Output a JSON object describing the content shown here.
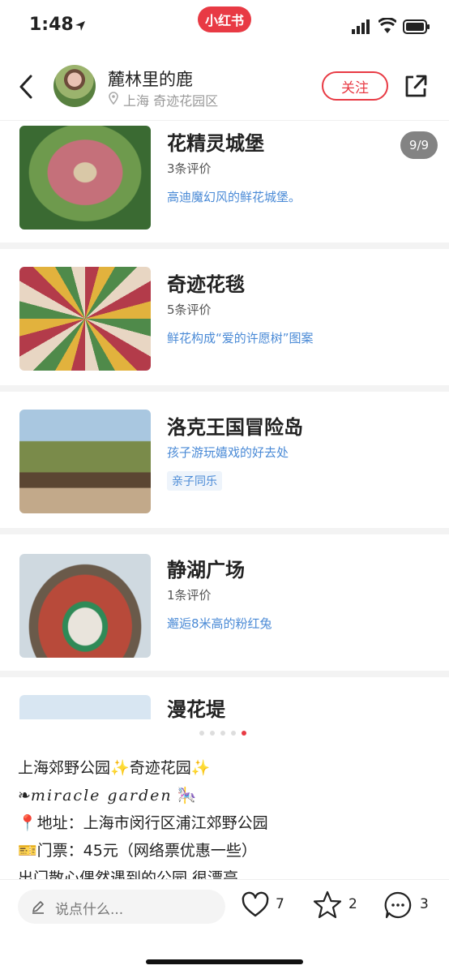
{
  "status_bar": {
    "time": "1:48",
    "brand": "小红书"
  },
  "header": {
    "author": "麓林里的鹿",
    "location": "上海 奇迹花园区",
    "follow_label": "关注"
  },
  "carousel": {
    "counter": "9/9",
    "cards": [
      {
        "title": "花精灵城堡",
        "meta": "3条评价",
        "desc": "高迪魔幻风的鲜花城堡。"
      },
      {
        "title": "奇迹花毯",
        "meta": "5条评价",
        "desc": "鲜花构成“爱的许愿树”图案"
      },
      {
        "title": "洛克王国冒险岛",
        "desc": "孩子游玩嬉戏的好去处",
        "tag": "亲子同乐"
      },
      {
        "title": "静湖广场",
        "meta": "1条评价",
        "desc": "邂逅8米高的粉红兔"
      },
      {
        "title": "漫花堤"
      }
    ]
  },
  "caption": {
    "line1": "上海郊野公园",
    "line1b": "奇迹花园",
    "line2": "miracle garden",
    "line3": "地址：上海市闵行区浦江郊野公园",
    "line4": "门票：45元（网络票优惠一些）",
    "line5": "出门散心偶然遇到的公园 很漂亮"
  },
  "bottom_bar": {
    "comment_placeholder": "说点什么...",
    "likes": "7",
    "stars": "2",
    "comments": "3"
  },
  "colors": {
    "brand": "#e83a44",
    "link": "#4a8ad6"
  }
}
